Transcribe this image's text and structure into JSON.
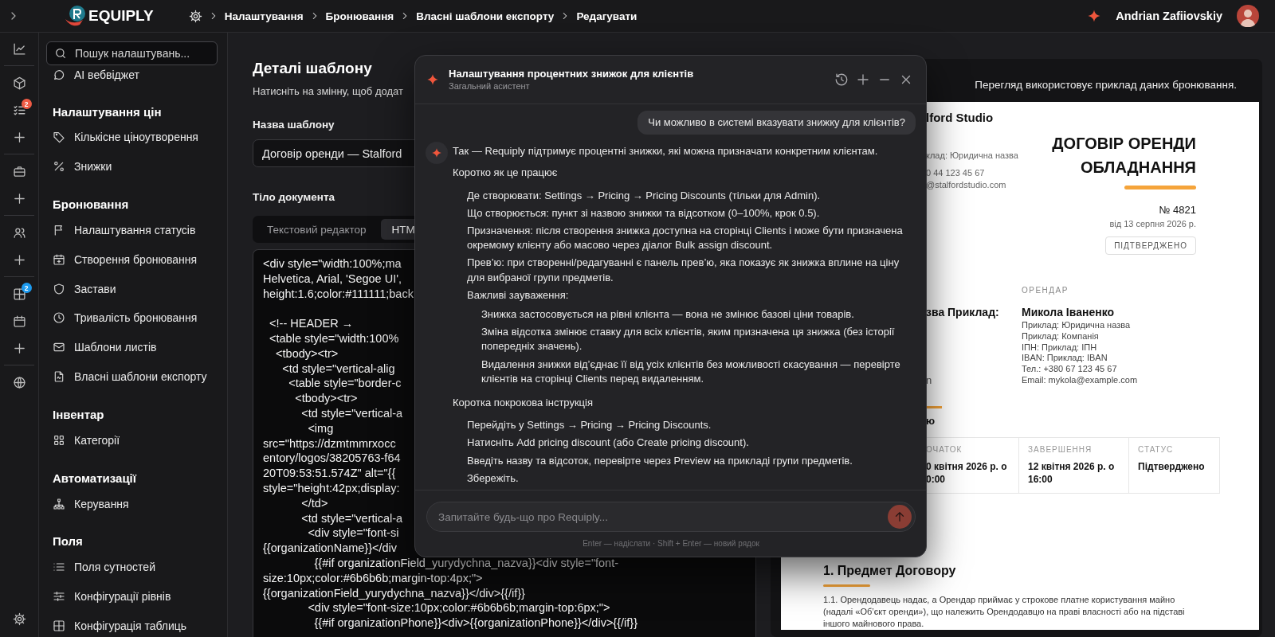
{
  "header": {
    "logo_text": "EQUIPLY",
    "breadcrumbs": [
      {
        "label": "Налаштування"
      },
      {
        "label": "Бронювання"
      },
      {
        "label": "Власні шаблони експорту"
      },
      {
        "label": "Редагувати"
      }
    ],
    "user_name": "Andrian Zafiiovskiy"
  },
  "rail_badges": [
    {
      "count": "2",
      "color": "#ef5b45"
    },
    {
      "count": "2",
      "color": "#1d9bf0"
    }
  ],
  "settings_nav": {
    "search_placeholder": "Пошук налаштувань...",
    "top_items": [
      {
        "label": "AI вебвіджет",
        "selected": false
      }
    ],
    "sections": [
      {
        "title": "Налаштування цін",
        "items": [
          {
            "label": "Кількісне ціноутворення",
            "selected": false
          },
          {
            "label": "Знижки",
            "selected": false
          }
        ]
      },
      {
        "title": "Бронювання",
        "items": [
          {
            "label": "Налаштування статусів",
            "selected": false
          },
          {
            "label": "Створення бронювання",
            "selected": false
          },
          {
            "label": "Застави",
            "selected": false
          },
          {
            "label": "Тривалість бронювання",
            "selected": false
          },
          {
            "label": "Шаблони листів",
            "selected": false
          },
          {
            "label": "Власні шаблони експорту",
            "selected": false
          }
        ]
      },
      {
        "title": "Інвентар",
        "items": [
          {
            "label": "Категорії",
            "selected": false
          }
        ]
      },
      {
        "title": "Автоматизації",
        "items": [
          {
            "label": "Керування",
            "selected": false
          }
        ]
      },
      {
        "title": "Поля",
        "items": [
          {
            "label": "Поля сутностей",
            "selected": false
          },
          {
            "label": "Конфігурації рівнів",
            "selected": false
          },
          {
            "label": "Конфігурація таблиць",
            "selected": false
          }
        ]
      }
    ]
  },
  "template": {
    "title": "Деталі шаблону",
    "hint": "Натисніть на змінну, щоб додат",
    "name_label": "Назва шаблону",
    "name_value": "Договір оренди — Stalford",
    "body_label": "Тіло документа",
    "editor_tabs": [
      {
        "label": "Текстовий редактор",
        "selected": false
      },
      {
        "label": "HTM",
        "selected": true
      }
    ],
    "code_blocks": [
      [
        "<div style=\"width:100%;ma",
        "Helvetica, Arial, 'Segoe UI',",
        "height:1.6;color:#111111;back"
      ],
      [
        "  <!-- HEADER →",
        "  <table style=\"width:100%",
        "    <tbody><tr>",
        "      <td style=\"vertical-alig",
        "        <table style=\"border-c",
        "          <tbody><tr>",
        "            <td style=\"vertical-a",
        "              <img",
        "src=\"https://dzmtmmrxocc",
        "entory/logos/38205763-f64",
        "20T09:53:51.574Z\" alt=\"{{",
        "style=\"height:42px;display:",
        "            </td>",
        "            <td style=\"vertical-a",
        "              <div style=\"font-si",
        "{{organizationName}}</div",
        "                {{#if organizationField_yurydychna_nazva}}<div style=\"font-",
        "size:10px;color:#6b6b6b;margin-top:4px;\">",
        "{{organizationField_yurydychna_nazva}}</div>{{/if}}",
        "              <div style=\"font-size:10px;color:#6b6b6b;margin-top:6px;\">",
        "                {{#if organizationPhone}}<div>{{organizationPhone}}</div>{{/if}}"
      ]
    ]
  },
  "preview": {
    "note": "Перегляд використовує приклад даних бронювання.",
    "org_fragments": [
      "lford Studio",
      "клад: Юридична назва",
      "0 44 123 45 67",
      "@stalfordstudio.com"
    ],
    "title_lines": [
      "ДОГОВІР ОРЕНДИ",
      "ОБЛАДНАННЯ"
    ],
    "number": "№ 4821",
    "date": "від 13 серпня 2026 р.",
    "status_badge": "ПІДТВЕРДЖЕНО",
    "landlord_fragments": [
      "зва Приклад:",
      "n"
    ],
    "renter": {
      "label": "ОРЕНДАР",
      "name": "Микола Іваненко",
      "lines": [
        "Приклад: Юридична назва",
        "Приклад: Компанія",
        "ІПН: Приклад: ІПН",
        "IBAN: Приклад: IBAN",
        "Тел.: +380 67 123 45 67",
        "Email: mykola@example.com"
      ]
    },
    "period_heading_fragment": "ю",
    "period_table": [
      {
        "label": "ОЧАТОК",
        "value_lines": [
          "0 квітня 2026 р. о",
          "0:00"
        ]
      },
      {
        "label": "ЗАВЕРШЕННЯ",
        "value_lines": [
          "12 квітня 2026 р. о",
          "16:00"
        ]
      },
      {
        "label": "СТАТУС",
        "value_lines": [
          "Підтверджено"
        ]
      }
    ],
    "sections": [
      {
        "heading": "1. Предмет Договору",
        "paragraph": "1.1. Орендодавець надає, а Орендар приймає у строкове платне користування майно (надалі «Об’єкт оренди»), що належить Орендодавцю на праві власності або на підставі іншого майнового права."
      }
    ]
  },
  "assistant": {
    "title": "Налаштування процентних знижок для клієнтів",
    "subtitle": "Загальний асистент",
    "messages": [
      {
        "kind": "user",
        "text": "Чи можливо в системі вказувати знижку для клієнтів?"
      },
      {
        "kind": "assistant",
        "text": "Так — Requiply підтримує процентні знижки, які можна призначати конкретним клієнтам.",
        "sections": [
          {
            "title": "Коротко як це працює",
            "items": [
              {
                "text": "Де створювати: Settings → Pricing → Pricing Discounts (тільки для Admin)."
              },
              {
                "text": "Що створюється: пункт зі назвою знижки та відсотком (0–100%, крок 0.5)."
              },
              {
                "text": "Призначення: після створення знижка доступна на сторінці Clients і може бути призначена окремому клієнту або масово через діалог Bulk assign discount."
              },
              {
                "text": "Прев’ю: при створенні/редагуванні є панель прев’ю, яка показує як знижка вплине на ціну для вибраної групи предметів."
              },
              {
                "text": "Важливі зауваження:",
                "children": [
                  {
                    "text": "Знижка застосовується на рівні клієнта — вона не змінює базові ціни товарів."
                  },
                  {
                    "text": "Зміна відсотка змінює ставку для всіх клієнтів, яким призначена ця знижка (без історії попередніх значень)."
                  },
                  {
                    "text": "Видалення знижки від’єднає її від усіх клієнтів без можливості скасування — перевірте клієнтів на сторінці Clients перед видаленням."
                  }
                ]
              }
            ]
          },
          {
            "title": "Коротка покрокова інструкція",
            "items": [
              {
                "text": "Перейдіть у Settings → Pricing → Pricing Discounts."
              },
              {
                "text": "Натисніть Add pricing discount (або Create pricing discount)."
              },
              {
                "text": "Введіть назву та відсоток, перевірте через Preview на прикладі групи предметів."
              },
              {
                "text": "Збережіть."
              }
            ]
          }
        ]
      }
    ],
    "input_placeholder": "Запитайте будь-що про Requiply...",
    "hint": "Enter — надіслати · Shift + Enter — новий рядок"
  }
}
